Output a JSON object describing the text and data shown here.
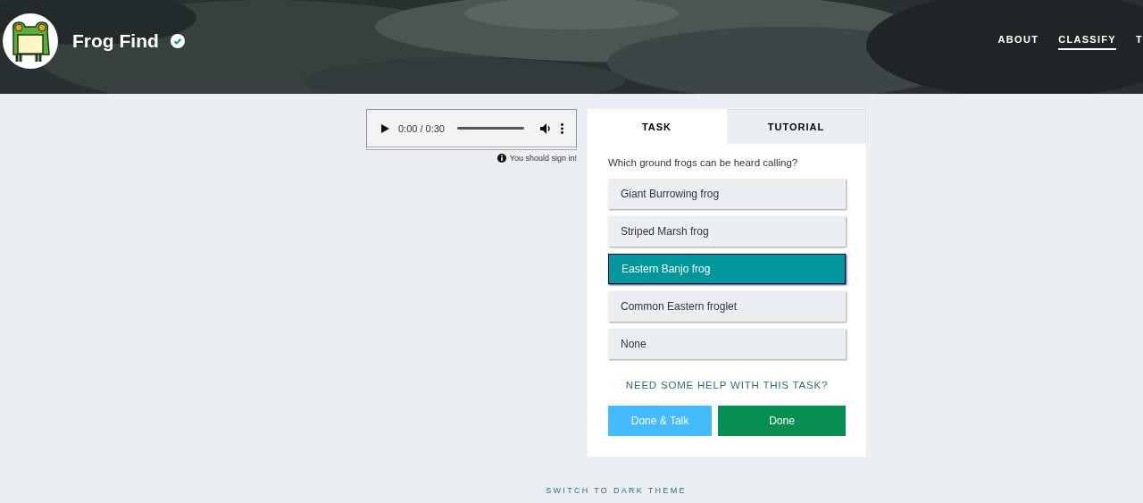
{
  "header": {
    "title": "Frog Find",
    "verified": true,
    "nav": [
      {
        "label": "ABOUT",
        "selected": false
      },
      {
        "label": "CLASSIFY",
        "selected": true
      },
      {
        "label": "T",
        "selected": false
      }
    ]
  },
  "player": {
    "time": "0:00 / 0:30",
    "notice": "You should sign in!"
  },
  "tabs": [
    {
      "label": "TASK",
      "selected": true
    },
    {
      "label": "TUTORIAL",
      "selected": false
    }
  ],
  "task": {
    "question": "Which ground frogs can be heard calling?",
    "options": [
      {
        "label": "Giant Burrowing frog",
        "selected": false
      },
      {
        "label": "Striped Marsh frog",
        "selected": false
      },
      {
        "label": "Eastern Banjo frog",
        "selected": true
      },
      {
        "label": "Common Eastern froglet",
        "selected": false
      },
      {
        "label": "None",
        "selected": false
      }
    ],
    "help": "NEED SOME HELP WITH THIS TASK?",
    "buttons": [
      {
        "label": "Done & Talk",
        "kind": "talk"
      },
      {
        "label": "Done",
        "kind": "done"
      }
    ]
  },
  "footer": {
    "theme_link": "SWITCH TO DARK THEME"
  }
}
